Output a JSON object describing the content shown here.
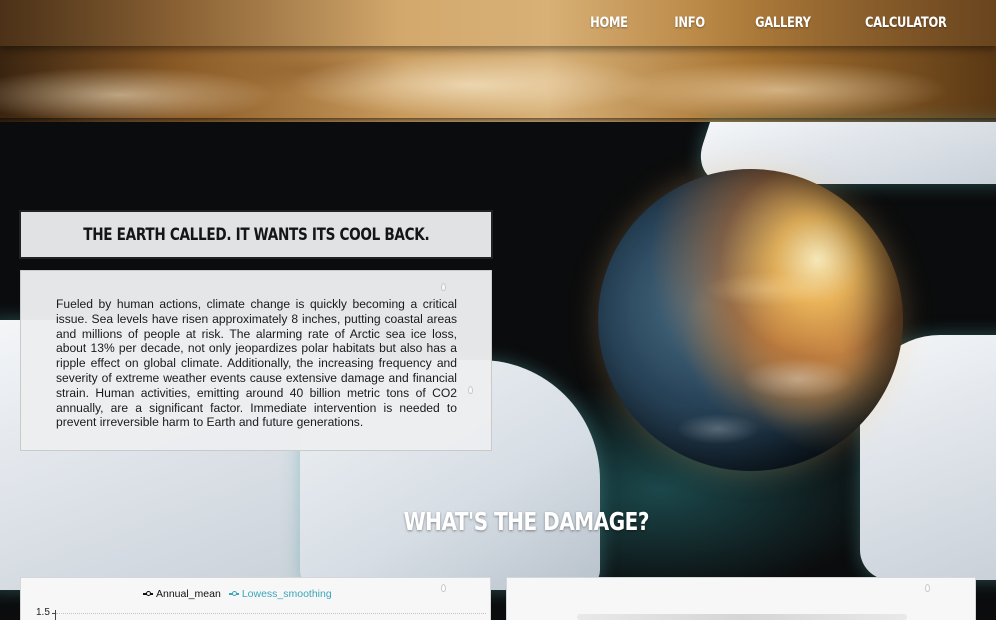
{
  "nav": {
    "items": [
      {
        "label": "HOME"
      },
      {
        "label": "INFO"
      },
      {
        "label": "GALLERY"
      },
      {
        "label": "CALCULATOR"
      }
    ]
  },
  "hero": {
    "headline": "THE EARTH CALLED. IT WANTS ITS COOL BACK.",
    "paragraph": "Fueled by human actions, climate change is quickly becoming a critical issue. Sea levels have risen approximately 8 inches, putting coastal areas and millions of people at risk. The alarming rate of Arctic sea ice loss, about 13% per decade, not only jeopardizes polar habitats but also has a ripple effect on global climate. Additionally, the increasing frequency and severity of extreme weather events cause extensive damage and financial strain. Human activities, emitting around 40 billion metric tons of CO2 annually, are a significant factor. Immediate intervention is needed to prevent irreversible harm to Earth and future generations."
  },
  "damage": {
    "heading": "WHAT'S THE DAMAGE?"
  },
  "chart": {
    "legend": [
      {
        "label": "Annual_mean",
        "color": "#111111"
      },
      {
        "label": "Lowess_smoothing",
        "color": "#3aa6b9"
      }
    ],
    "y_tick": "1.5"
  },
  "colors": {
    "background": "#0b0c0d",
    "panel": "#e1e2e4",
    "accent_teal": "#3aa6b9",
    "banner_gold": "#c89a5c"
  }
}
